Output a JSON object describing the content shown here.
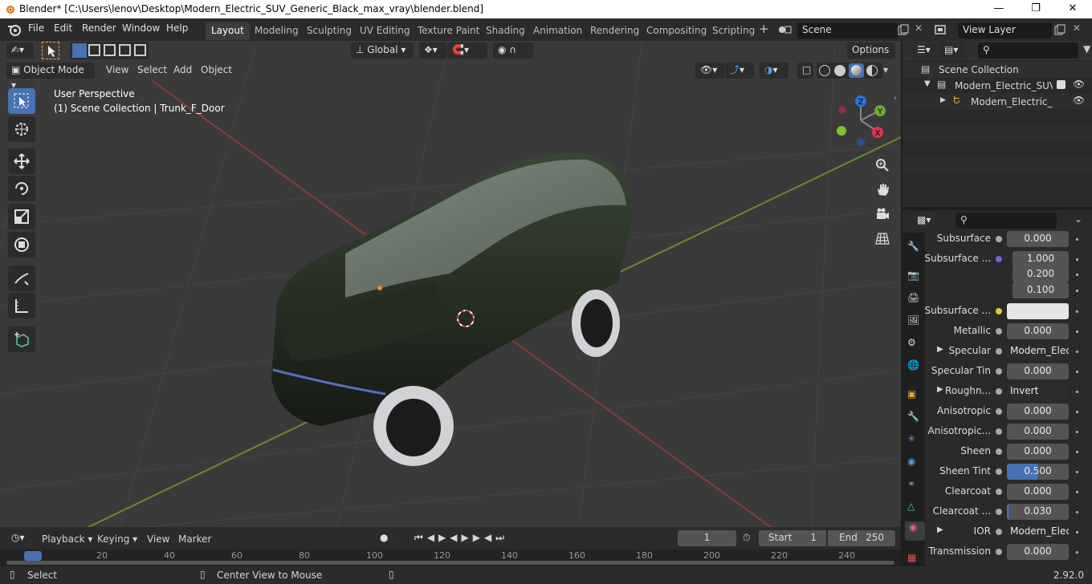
{
  "window": {
    "title": "Blender* [C:\\Users\\lenov\\Desktop\\Modern_Electric_SUV_Generic_Black_max_vray\\blender.blend]"
  },
  "menu": [
    "File",
    "Edit",
    "Render",
    "Window",
    "Help"
  ],
  "workspaces": [
    "Layout",
    "Modeling",
    "Sculpting",
    "UV Editing",
    "Texture Paint",
    "Shading",
    "Animation",
    "Rendering",
    "Compositing",
    "Scripting"
  ],
  "scene_name": "Scene",
  "view_layer": "View Layer",
  "viewport": {
    "mode": "Object Mode",
    "menus": [
      "View",
      "Select",
      "Add",
      "Object"
    ],
    "transform_orientation": "Global",
    "options_label": "Options",
    "info_line1": "User Perspective",
    "info_line2": "(1) Scene Collection | Trunk_F_Door"
  },
  "gizmo": {
    "x": "X",
    "y": "Y",
    "z": "Z"
  },
  "outliner": {
    "root": "Scene Collection",
    "items": [
      {
        "label": "Modern_Electric_SUV_Ge"
      },
      {
        "label": "Modern_Electric_SU\\"
      }
    ]
  },
  "properties": {
    "rows": [
      {
        "label": "Subsurface",
        "value": "0.000",
        "kind": "num"
      },
      {
        "label": "Subsurface ...",
        "value": "1.000",
        "kind": "num"
      },
      {
        "label": "",
        "value": "0.200",
        "kind": "num"
      },
      {
        "label": "",
        "value": "0.100",
        "kind": "num"
      },
      {
        "label": "Subsurface ...",
        "value": "",
        "kind": "color"
      },
      {
        "label": "Metallic",
        "value": "0.000",
        "kind": "num"
      },
      {
        "label": "Specular",
        "value": "Modern_Elect...",
        "kind": "link"
      },
      {
        "label": "Specular Tin",
        "value": "0.000",
        "kind": "num"
      },
      {
        "label": "Roughn...",
        "value": "Invert",
        "kind": "link"
      },
      {
        "label": "Anisotropic",
        "value": "0.000",
        "kind": "num"
      },
      {
        "label": "Anisotropic...",
        "value": "0.000",
        "kind": "num"
      },
      {
        "label": "Sheen",
        "value": "0.000",
        "kind": "num"
      },
      {
        "label": "Sheen Tint",
        "value": "0.500",
        "kind": "num",
        "fraction": 0.5
      },
      {
        "label": "Clearcoat",
        "value": "0.000",
        "kind": "num"
      },
      {
        "label": "Clearcoat ...",
        "value": "0.030",
        "kind": "num",
        "fraction": 0.03
      },
      {
        "label": "IOR",
        "value": "Modern_Elect...",
        "kind": "link"
      },
      {
        "label": "Transmission",
        "value": "0.000",
        "kind": "num"
      }
    ]
  },
  "timeline": {
    "menus": [
      "Playback",
      "Keying",
      "View",
      "Marker"
    ],
    "current_frame": "1",
    "start_label": "Start",
    "start": "1",
    "end_label": "End",
    "end": "250",
    "ruler": [
      "1",
      "20",
      "40",
      "60",
      "80",
      "100",
      "120",
      "140",
      "160",
      "180",
      "200",
      "220",
      "240"
    ]
  },
  "status": {
    "left": "Select",
    "middle": "Center View to Mouse",
    "version": "2.92.0"
  }
}
